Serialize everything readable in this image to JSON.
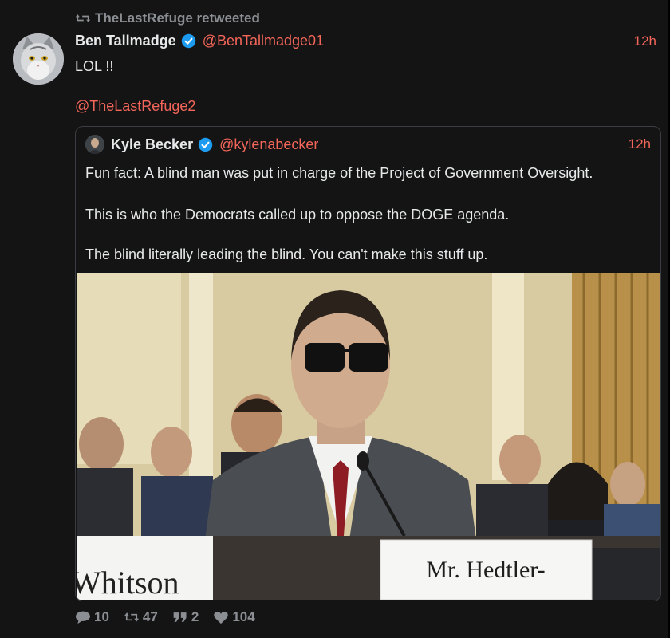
{
  "retweet": {
    "label": "TheLastRefuge retweeted"
  },
  "tweet": {
    "author_name": "Ben Tallmadge",
    "handle": "@BenTallmadge01",
    "time": "12h",
    "text": "LOL !!",
    "mention": "@TheLastRefuge2"
  },
  "quote": {
    "author_name": "Kyle Becker",
    "handle": "@kylenabecker",
    "time": "12h",
    "paragraphs": [
      "Fun fact: A blind man was put in charge of the Project of Government Oversight.",
      "This is who the Democrats called up to oppose the DOGE agenda.",
      "The blind literally leading the blind. You can't make this stuff up."
    ],
    "media": {
      "placard_main": "Mr. Hedtler-",
      "placard_left": "Whitson"
    }
  },
  "actions": {
    "replies": "10",
    "retweets": "47",
    "quotes": "2",
    "likes": "104"
  },
  "colors": {
    "accent": "#f4665a",
    "muted": "#8b8f94",
    "verified": "#1d9bf0",
    "background": "#141414"
  },
  "icons": [
    "retweet-icon",
    "verified-icon",
    "reply-icon",
    "quote-icon",
    "like-icon"
  ]
}
